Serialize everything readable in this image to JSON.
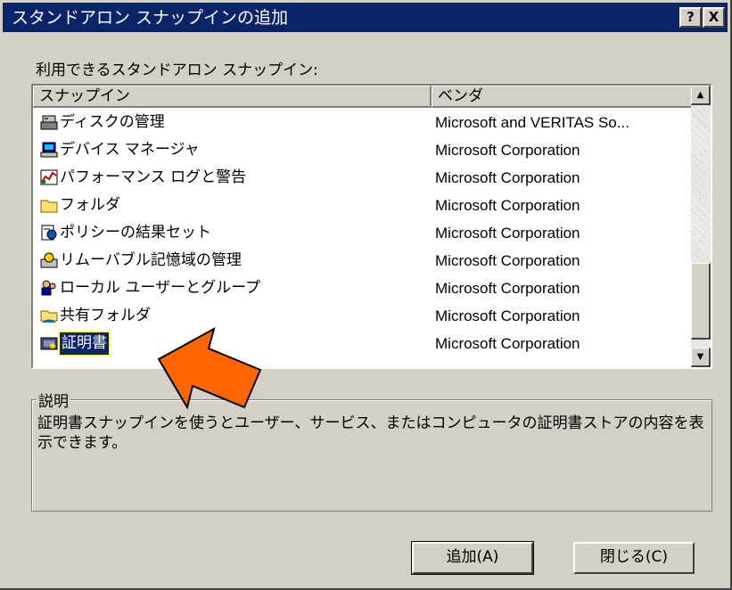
{
  "window": {
    "title": "スタンドアロン スナップインの追加",
    "help_label": "?",
    "close_label": "X"
  },
  "list_label": "利用できるスタンドアロン スナップイン:",
  "columns": {
    "name": "スナップイン",
    "vendor": "ベンダ"
  },
  "rows": [
    {
      "name": "ディスクの管理",
      "vendor": "Microsoft and VERITAS So...",
      "icon": "disk-icon"
    },
    {
      "name": "デバイス マネージャ",
      "vendor": "Microsoft Corporation",
      "icon": "computer-icon"
    },
    {
      "name": "パフォーマンス ログと警告",
      "vendor": "Microsoft Corporation",
      "icon": "performance-icon"
    },
    {
      "name": "フォルダ",
      "vendor": "Microsoft Corporation",
      "icon": "folder-icon"
    },
    {
      "name": "ポリシーの結果セット",
      "vendor": "Microsoft Corporation",
      "icon": "policy-icon"
    },
    {
      "name": "リムーバブル記憶域の管理",
      "vendor": "Microsoft Corporation",
      "icon": "removable-storage-icon"
    },
    {
      "name": "ローカル ユーザーとグループ",
      "vendor": "Microsoft Corporation",
      "icon": "users-icon"
    },
    {
      "name": "共有フォルダ",
      "vendor": "Microsoft Corporation",
      "icon": "shared-folder-icon"
    },
    {
      "name": "証明書",
      "vendor": "Microsoft Corporation",
      "icon": "certificate-icon",
      "selected": true
    }
  ],
  "description": {
    "title": "説明",
    "text": "証明書スナップインを使うとユーザー、サービス、またはコンピュータの証明書ストアの内容を表示できます。"
  },
  "buttons": {
    "add": "追加(A)",
    "close": "閉じる(C)"
  },
  "colors": {
    "titlebar": "#0a246a",
    "face": "#d4d0c8",
    "selection": "#0a246a",
    "annotation_arrow": "#ff6600"
  }
}
